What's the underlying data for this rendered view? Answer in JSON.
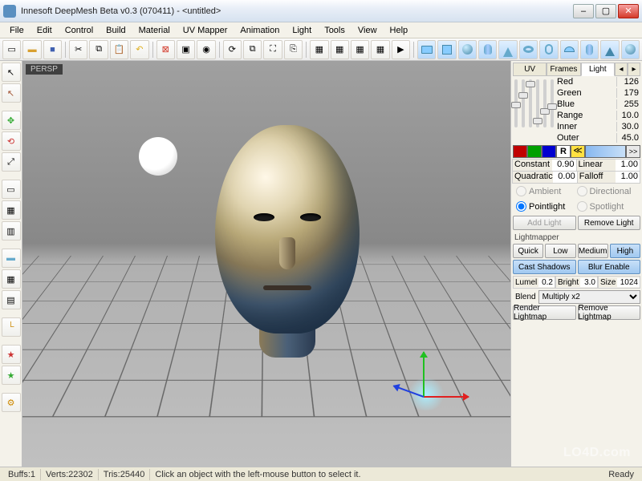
{
  "window": {
    "title": "Innesoft DeepMesh Beta v0.3 (070411) - <untitled>"
  },
  "menu": [
    "File",
    "Edit",
    "Control",
    "Build",
    "Material",
    "UV Mapper",
    "Animation",
    "Light",
    "Tools",
    "View",
    "Help"
  ],
  "viewport": {
    "label": "PERSP"
  },
  "panel": {
    "tabs": {
      "uv": "UV",
      "frames": "Frames",
      "light": "Light"
    },
    "rgb": [
      {
        "k": "Red",
        "v": "126"
      },
      {
        "k": "Green",
        "v": "179"
      },
      {
        "k": "Blue",
        "v": "255"
      },
      {
        "k": "Range",
        "v": "10.0"
      },
      {
        "k": "Inner",
        "v": "30.0"
      },
      {
        "k": "Outer",
        "v": "45.0"
      }
    ],
    "swatch_btn": ">>",
    "atten": {
      "constant_k": "Constant",
      "constant_v": "0.90",
      "linear_k": "Linear",
      "linear_v": "1.00",
      "quadratic_k": "Quadratic",
      "quadratic_v": "0.00",
      "falloff_k": "Falloff",
      "falloff_v": "1.00"
    },
    "types": {
      "ambient": "Ambient",
      "directional": "Directional",
      "pointlight": "Pointlight",
      "spotlight": "Spotlight"
    },
    "btns": {
      "add": "Add Light",
      "remove": "Remove Light"
    },
    "lightmapper": "Lightmapper",
    "quality": {
      "quick": "Quick",
      "low": "Low",
      "medium": "Medium",
      "high": "High"
    },
    "opts": {
      "shadows": "Cast Shadows",
      "blur": "Blur Enable"
    },
    "lm": {
      "lumel_k": "Lumel",
      "lumel_v": "0.2",
      "bright_k": "Bright",
      "bright_v": "3.0",
      "size_k": "Size",
      "size_v": "1024"
    },
    "blend_k": "Blend",
    "blend_v": "Multiply x2",
    "render": "Render Lightmap",
    "removelm": "Remove Lightmap"
  },
  "status": {
    "buffs": "Buffs:1",
    "verts": "Verts:22302",
    "tris": "Tris:25440",
    "hint": "Click an object with the left-mouse button to select it.",
    "ready": "Ready"
  },
  "watermark": "LO4D.com"
}
